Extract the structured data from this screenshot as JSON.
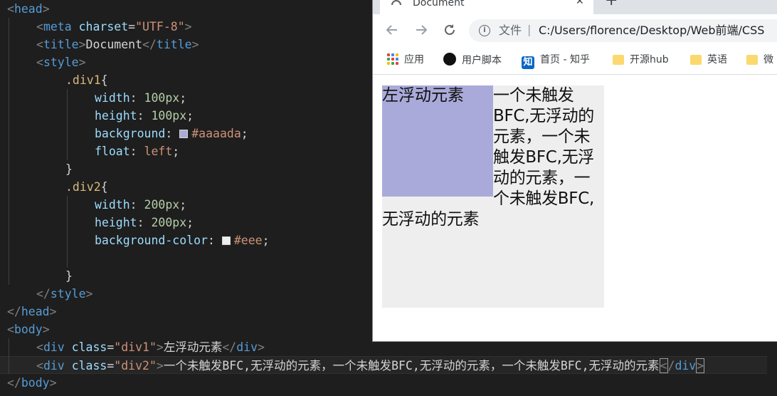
{
  "editor": {
    "lines": [
      {
        "indent": 0,
        "tokens": [
          [
            "punct",
            "<"
          ],
          [
            "tag",
            "head"
          ],
          [
            "punct",
            ">"
          ]
        ]
      },
      {
        "indent": 1,
        "tokens": [
          [
            "punct",
            "<"
          ],
          [
            "tag",
            "meta"
          ],
          [
            "text",
            " "
          ],
          [
            "attr",
            "charset"
          ],
          [
            "text",
            "="
          ],
          [
            "str",
            "\"UTF-8\""
          ],
          [
            "punct",
            ">"
          ]
        ]
      },
      {
        "indent": 1,
        "tokens": [
          [
            "punct",
            "<"
          ],
          [
            "tag",
            "title"
          ],
          [
            "punct",
            ">"
          ],
          [
            "text",
            "Document"
          ],
          [
            "punct",
            "</"
          ],
          [
            "tag",
            "title"
          ],
          [
            "punct",
            ">"
          ]
        ]
      },
      {
        "indent": 1,
        "tokens": [
          [
            "punct",
            "<"
          ],
          [
            "tag",
            "style"
          ],
          [
            "punct",
            ">"
          ]
        ]
      },
      {
        "indent": 2,
        "tokens": [
          [
            "sel",
            ".div1"
          ],
          [
            "text",
            "{"
          ]
        ]
      },
      {
        "indent": 3,
        "tokens": [
          [
            "attr",
            "width"
          ],
          [
            "text",
            ": "
          ],
          [
            "num",
            "100px"
          ],
          [
            "text",
            ";"
          ]
        ]
      },
      {
        "indent": 3,
        "tokens": [
          [
            "attr",
            "height"
          ],
          [
            "text",
            ": "
          ],
          [
            "num",
            "100px"
          ],
          [
            "text",
            ";"
          ]
        ]
      },
      {
        "indent": 3,
        "tokens": [
          [
            "attr",
            "background"
          ],
          [
            "text",
            ": "
          ],
          [
            "swatch",
            "#aaaada"
          ],
          [
            "val",
            "#aaaada"
          ],
          [
            "text",
            ";"
          ]
        ]
      },
      {
        "indent": 3,
        "tokens": [
          [
            "attr",
            "float"
          ],
          [
            "text",
            ": "
          ],
          [
            "val",
            "left"
          ],
          [
            "text",
            ";"
          ]
        ]
      },
      {
        "indent": 2,
        "tokens": [
          [
            "text",
            "}"
          ]
        ]
      },
      {
        "indent": 2,
        "tokens": [
          [
            "sel",
            ".div2"
          ],
          [
            "text",
            "{"
          ]
        ]
      },
      {
        "indent": 3,
        "tokens": [
          [
            "attr",
            "width"
          ],
          [
            "text",
            ": "
          ],
          [
            "num",
            "200px"
          ],
          [
            "text",
            ";"
          ]
        ]
      },
      {
        "indent": 3,
        "tokens": [
          [
            "attr",
            "height"
          ],
          [
            "text",
            ": "
          ],
          [
            "num",
            "200px"
          ],
          [
            "text",
            ";"
          ]
        ]
      },
      {
        "indent": 3,
        "tokens": [
          [
            "attr",
            "background-color"
          ],
          [
            "text",
            ": "
          ],
          [
            "swatch",
            "#eeeeee"
          ],
          [
            "val",
            "#eee"
          ],
          [
            "text",
            ";"
          ]
        ]
      },
      {
        "indent": 0,
        "tokens": []
      },
      {
        "indent": 2,
        "tokens": [
          [
            "text",
            "}"
          ]
        ]
      },
      {
        "indent": 1,
        "tokens": [
          [
            "punct",
            "</"
          ],
          [
            "tag",
            "style"
          ],
          [
            "punct",
            ">"
          ]
        ]
      },
      {
        "indent": 0,
        "tokens": [
          [
            "punct",
            "</"
          ],
          [
            "tag",
            "head"
          ],
          [
            "punct",
            ">"
          ]
        ]
      },
      {
        "indent": 0,
        "tokens": [
          [
            "punct",
            "<"
          ],
          [
            "tag",
            "body"
          ],
          [
            "punct",
            ">"
          ]
        ]
      },
      {
        "indent": 1,
        "tokens": [
          [
            "punct",
            "<"
          ],
          [
            "tag",
            "div"
          ],
          [
            "text",
            " "
          ],
          [
            "attr",
            "class"
          ],
          [
            "text",
            "="
          ],
          [
            "str",
            "\"div1\""
          ],
          [
            "punct",
            ">"
          ],
          [
            "text",
            "左浮动元素"
          ],
          [
            "punct",
            "</"
          ],
          [
            "tag",
            "div"
          ],
          [
            "punct",
            ">"
          ]
        ]
      },
      {
        "indent": 1,
        "active": true,
        "tokens": [
          [
            "punct",
            "<"
          ],
          [
            "tag",
            "div"
          ],
          [
            "text",
            " "
          ],
          [
            "attr",
            "class"
          ],
          [
            "text",
            "="
          ],
          [
            "str",
            "\"div2\""
          ],
          [
            "punct",
            ">"
          ],
          [
            "text",
            "一个未触发BFC,无浮动的元素，一个未触发BFC,无浮动的元素，一个未触发BFC,无浮动的元素"
          ],
          [
            "cursor",
            "<"
          ],
          [
            "punct",
            "/"
          ],
          [
            "tag",
            "div"
          ],
          [
            "cursor",
            ">"
          ]
        ]
      },
      {
        "indent": 0,
        "tokens": [
          [
            "punct",
            "</"
          ],
          [
            "tag",
            "body"
          ],
          [
            "punct",
            ">"
          ]
        ]
      }
    ]
  },
  "browser": {
    "tab_title": "Document",
    "tab_close": "✕",
    "new_tab": "+",
    "omnibox": {
      "label": "文件",
      "separator": "|",
      "url": "C:/Users/florence/Desktop/Web前端/CSS"
    },
    "bookmarks": [
      {
        "label": "应用",
        "icon": "apps-icon"
      },
      {
        "label": "用户脚本",
        "icon": "ghost-icon"
      },
      {
        "label": "首页 - 知乎",
        "icon": "zhihu-icon",
        "icon_text": "知"
      },
      {
        "label": "开源hub",
        "icon": "folder-icon"
      },
      {
        "label": "英语",
        "icon": "folder-icon"
      },
      {
        "label": "微",
        "icon": "folder-icon"
      }
    ],
    "page": {
      "div1_text": "左浮动元素",
      "div2_text": "一个未触发BFC,无浮动的元素，一个未触发BFC,无浮动的元素，一个未触发BFC,无浮动的元素",
      "div1_color": "#aaaada",
      "div2_color": "#eeeeee"
    }
  }
}
